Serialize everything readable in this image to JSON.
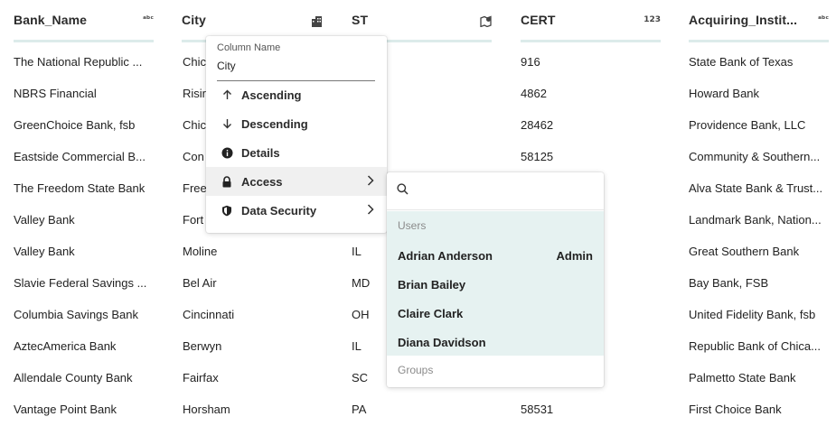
{
  "columns": [
    {
      "title": "Bank_Name",
      "type_icon": "abc-text-icon",
      "type_glyph": "ᵃᵇᶜ"
    },
    {
      "title": "City",
      "type_icon": "city-icon"
    },
    {
      "title": "ST",
      "type_icon": "map-pin-icon"
    },
    {
      "title": "CERT",
      "type_icon": "number-icon",
      "type_glyph": "123"
    },
    {
      "title": "Acquiring_Instit...",
      "type_icon": "abc-text-icon",
      "type_glyph": "ᵃᵇᶜ"
    }
  ],
  "rows": [
    {
      "bank": "The National Republic ...",
      "city": "Chic",
      "st": "",
      "cert": "916",
      "acq": "State Bank of Texas"
    },
    {
      "bank": "NBRS Financial",
      "city": "Risir",
      "st": "",
      "cert": "4862",
      "acq": "Howard Bank"
    },
    {
      "bank": "GreenChoice Bank, fsb",
      "city": "Chic",
      "st": "",
      "cert": "28462",
      "acq": "Providence Bank, LLC"
    },
    {
      "bank": "Eastside Commercial B...",
      "city": "Con",
      "st": "",
      "cert": "58125",
      "acq": "Community & Southern..."
    },
    {
      "bank": "The Freedom State Bank",
      "city": "Free",
      "st": "",
      "cert": "",
      "acq": "Alva State Bank & Trust..."
    },
    {
      "bank": "Valley Bank",
      "city": "Fort",
      "st": "",
      "cert": "",
      "acq": "Landmark Bank, Nation..."
    },
    {
      "bank": "Valley Bank",
      "city": "Moline",
      "st": "IL",
      "cert": "",
      "acq": "Great Southern Bank"
    },
    {
      "bank": "Slavie Federal Savings ...",
      "city": "Bel Air",
      "st": "MD",
      "cert": "",
      "acq": "Bay Bank, FSB"
    },
    {
      "bank": "Columbia Savings Bank",
      "city": "Cincinnati",
      "st": "OH",
      "cert": "",
      "acq": "United Fidelity Bank, fsb"
    },
    {
      "bank": "AztecAmerica Bank",
      "city": "Berwyn",
      "st": "IL",
      "cert": "",
      "acq": "Republic Bank of Chica..."
    },
    {
      "bank": "Allendale County Bank",
      "city": "Fairfax",
      "st": "SC",
      "cert": "",
      "acq": "Palmetto State Bank"
    },
    {
      "bank": "Vantage Point Bank",
      "city": "Horsham",
      "st": "PA",
      "cert": "58531",
      "acq": "First Choice Bank"
    }
  ],
  "column_menu": {
    "name_label": "Column Name",
    "name_value": "City",
    "items": [
      {
        "label": "Ascending",
        "icon": "arrow-up-icon"
      },
      {
        "label": "Descending",
        "icon": "arrow-down-icon"
      },
      {
        "label": "Details",
        "icon": "info-icon"
      },
      {
        "label": "Access",
        "icon": "lock-icon"
      },
      {
        "label": "Data Security",
        "icon": "shield-icon"
      }
    ]
  },
  "access_menu": {
    "search_placeholder": "",
    "users_label": "Users",
    "users": [
      {
        "name": "Adrian Anderson",
        "role": "Admin"
      },
      {
        "name": "Brian Bailey",
        "role": ""
      },
      {
        "name": "Claire Clark",
        "role": ""
      },
      {
        "name": "Diana Davidson",
        "role": ""
      }
    ],
    "groups_label": "Groups"
  },
  "colors": {
    "header_underline": "#dcebea",
    "selected_list_bg": "#e6f2f1"
  }
}
